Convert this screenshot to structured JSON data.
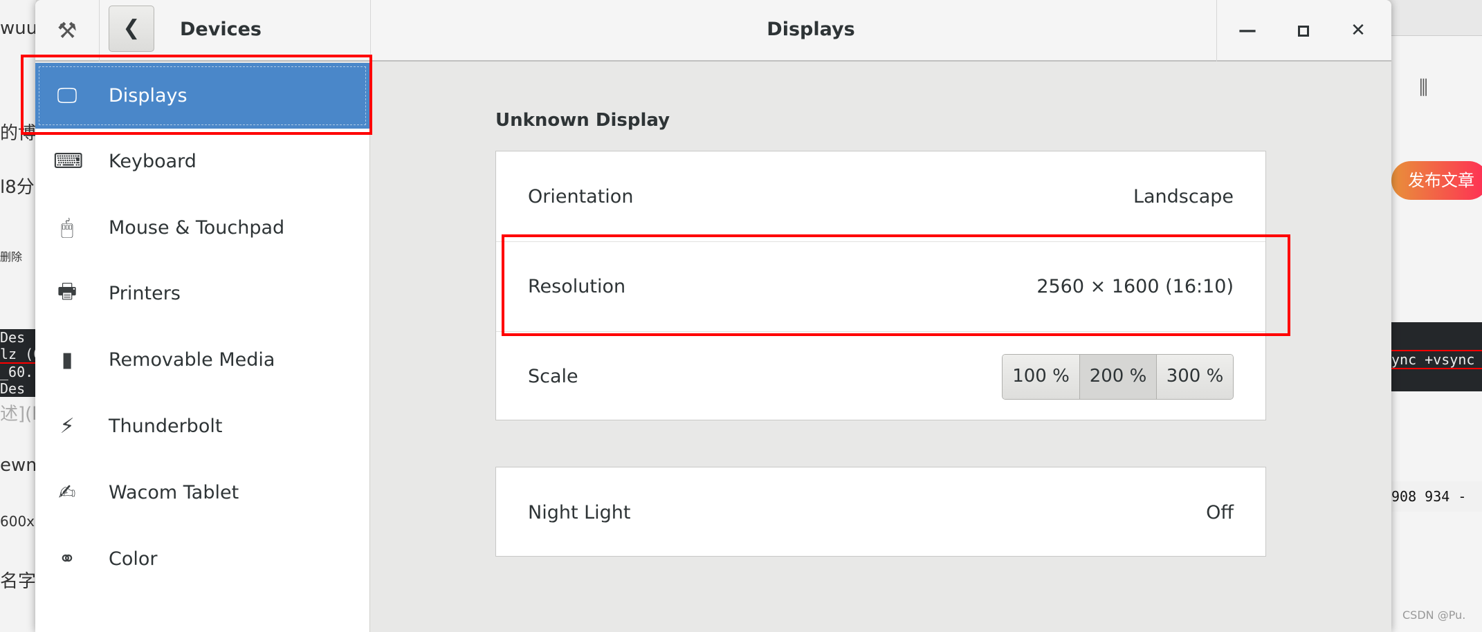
{
  "background": {
    "left_fragments": [
      "wuu",
      "的博客",
      "l8分",
      "删除",
      "Des",
      "lz (C",
      "_60.",
      "Des",
      "述](ht",
      "ewmo",
      "600x",
      "名字"
    ],
    "right_fragments": [
      "发布文章",
      "ync +vsync",
      "908 934 -",
      "CSDN @Pu."
    ]
  },
  "header": {
    "sidebar_title": "Devices",
    "page_title": "Displays"
  },
  "sidebar": {
    "items": [
      {
        "label": "Displays",
        "icon": "display-icon",
        "selected": true
      },
      {
        "label": "Keyboard",
        "icon": "keyboard-icon"
      },
      {
        "label": "Mouse & Touchpad",
        "icon": "mouse-icon"
      },
      {
        "label": "Printers",
        "icon": "printer-icon"
      },
      {
        "label": "Removable Media",
        "icon": "usb-drive-icon"
      },
      {
        "label": "Thunderbolt",
        "icon": "thunderbolt-icon"
      },
      {
        "label": "Wacom Tablet",
        "icon": "tablet-icon"
      },
      {
        "label": "Color",
        "icon": "color-icon"
      }
    ]
  },
  "display": {
    "name": "Unknown Display",
    "orientation_label": "Orientation",
    "orientation_value": "Landscape",
    "resolution_label": "Resolution",
    "resolution_value": "2560 × 1600 (16:10)",
    "scale_label": "Scale",
    "scale_options": [
      "100 %",
      "200 %",
      "300 %"
    ],
    "scale_selected": "200 %",
    "night_light_label": "Night Light",
    "night_light_value": "Off"
  },
  "annotation_color": "#ff0000",
  "accent_color": "#4a87c9"
}
